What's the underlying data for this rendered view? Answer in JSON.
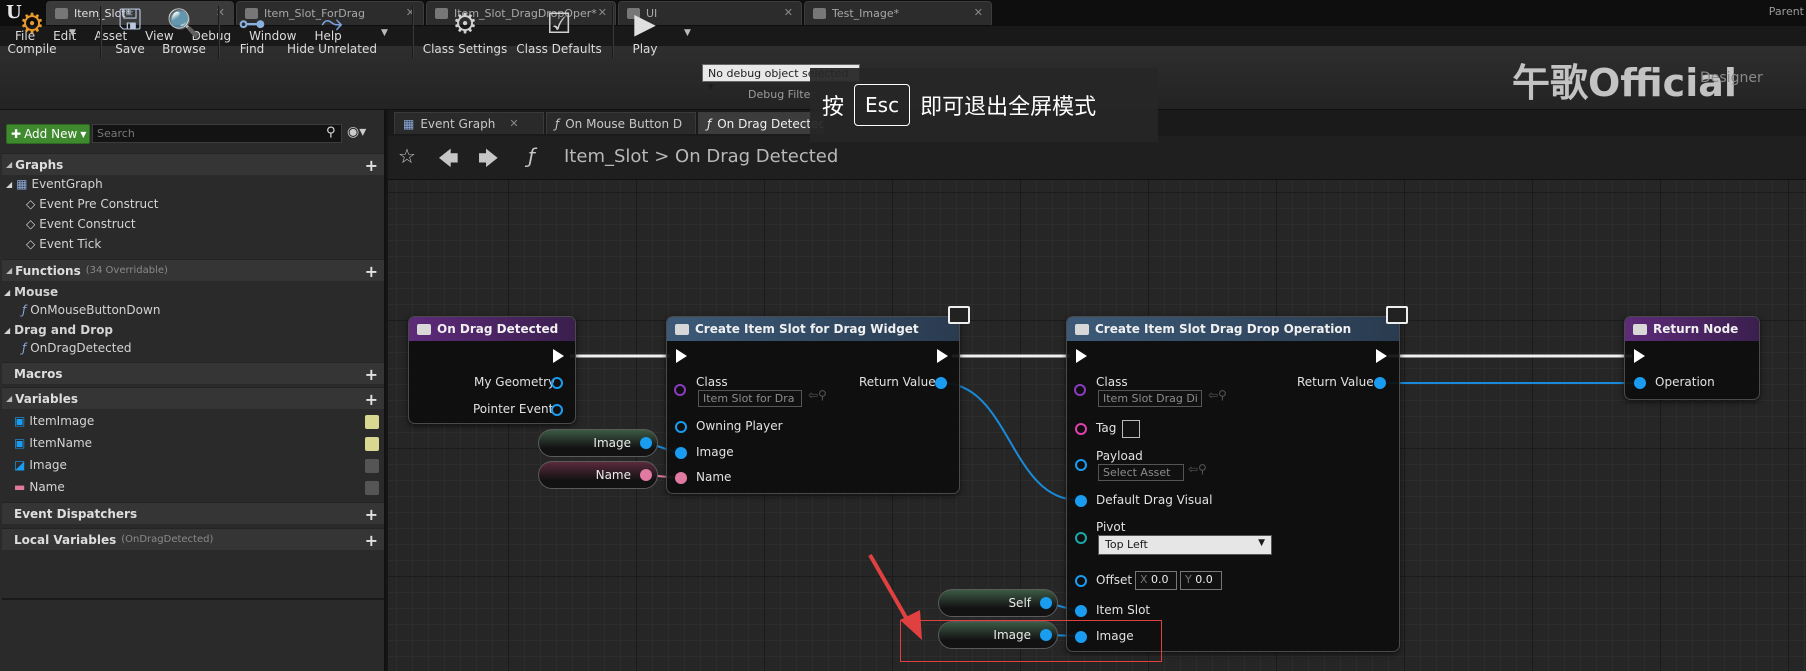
{
  "title_tabs": [
    "Item_Slot*",
    "Item_Slot_ForDrag",
    "Item_Slot_DragDropOper*",
    "UI",
    "Test_Image*"
  ],
  "parent_label": "Parent",
  "menu": [
    "File",
    "Edit",
    "Asset",
    "View",
    "Debug",
    "Window",
    "Help"
  ],
  "toolbar": {
    "compile": "Compile",
    "save": "Save",
    "browse": "Browse",
    "find": "Find",
    "hide_unrelated": "Hide Unrelated",
    "class_settings": "Class Settings",
    "class_defaults": "Class Defaults",
    "play": "Play",
    "debug_select": "No debug object selected",
    "debug_filter": "Debug Filter",
    "designer": "Designer"
  },
  "watermark": "午歌Official",
  "esc_overlay": {
    "pre": "按",
    "key": "Esc",
    "post": "即可退出全屏模式"
  },
  "left_panel": {
    "add_new": "Add New",
    "search_placeholder": "Search",
    "graphs": {
      "header": "Graphs",
      "items": [
        "EventGraph",
        "Event Pre Construct",
        "Event Construct",
        "Event Tick"
      ]
    },
    "functions": {
      "header": "Functions",
      "overridable": "(34 Overridable)",
      "mouse": "Mouse",
      "mouse_items": [
        "OnMouseButtonDown"
      ],
      "dragdrop": "Drag and Drop",
      "dragdrop_items": [
        "OnDragDetected"
      ]
    },
    "macros": "Macros",
    "variables": {
      "header": "Variables",
      "items": [
        "ItemImage",
        "ItemName",
        "Image",
        "Name"
      ]
    },
    "event_dispatchers": "Event Dispatchers",
    "local_variables": {
      "header": "Local Variables",
      "sub": "(OnDragDetected)"
    }
  },
  "graph_tabs": [
    "Event Graph",
    "On Mouse Button D",
    "On Drag Detected"
  ],
  "breadcrumb": {
    "root": "Item_Slot",
    "sep": ">",
    "current": "On Drag Detected"
  },
  "nodes": {
    "on_drag": {
      "title": "On Drag Detected",
      "pins": [
        "My Geometry",
        "Pointer Event"
      ]
    },
    "create_widget": {
      "title": "Create Item Slot for Drag Widget",
      "class_label": "Class",
      "class_value": "Item Slot for Dra",
      "return_value": "Return Value",
      "pins": [
        "Owning Player",
        "Image",
        "Name"
      ]
    },
    "create_op": {
      "title": "Create Item Slot Drag Drop Operation",
      "class_label": "Class",
      "class_value": "Item Slot Drag Di",
      "return_value": "Return Value",
      "tag": "Tag",
      "payload": "Payload",
      "payload_value": "Select Asset",
      "default_drag_visual": "Default Drag Visual",
      "pivot": "Pivot",
      "pivot_value": "Top Left",
      "offset": "Offset",
      "offset_x_label": "X",
      "offset_x": "0.0",
      "offset_y_label": "Y",
      "offset_y": "0.0",
      "item_slot": "Item Slot",
      "image": "Image"
    },
    "return_node": {
      "title": "Return Node",
      "pin": "Operation"
    },
    "var_image_1": "Image",
    "var_name": "Name",
    "var_self": "Self",
    "var_image_2": "Image"
  },
  "colors": {
    "accent_green": "#3f8a2f",
    "object_pin": "#1a9cf0",
    "string_pin": "#e07aa0",
    "function_header": "#5e2a7a",
    "node_header": "#3c5a78",
    "annotation": "#e04040"
  }
}
